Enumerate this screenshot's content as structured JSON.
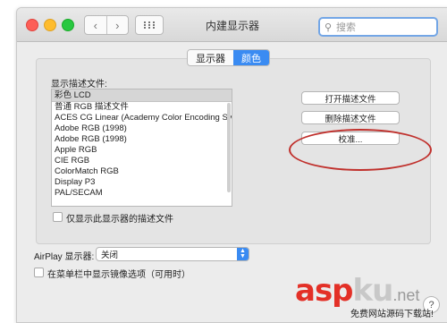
{
  "window": {
    "title": "内建显示器"
  },
  "toolbar": {
    "back": "‹",
    "forward": "›",
    "search_placeholder": "搜索"
  },
  "tabs": [
    {
      "label": "显示器",
      "selected": false
    },
    {
      "label": "颜色",
      "selected": true
    }
  ],
  "profiles": {
    "heading": "显示描述文件:",
    "selected": "彩色 LCD",
    "items": [
      "普通 RGB 描述文件",
      "ACES CG Linear (Academy Color Encoding Sy...",
      "Adobe RGB (1998)",
      "Adobe RGB (1998)",
      "Apple RGB",
      "CIE RGB",
      "ColorMatch RGB",
      "Display P3",
      "PAL/SECAM"
    ],
    "only_this_display": "仅显示此显示器的描述文件"
  },
  "buttons": {
    "open": "打开描述文件",
    "delete": "删除描述文件",
    "calibrate": "校准..."
  },
  "airplay": {
    "label": "AirPlay 显示器:",
    "value": "关闭"
  },
  "mirroring": {
    "label": "在菜单栏中显示镜像选项（可用时）"
  },
  "help": "?",
  "watermark": {
    "asp": "asp",
    "ku": "ku",
    "net": ".net",
    "sub": "免费网站源码下载站!"
  },
  "colors": {
    "accent": "#3a8bf2",
    "annotation": "#c0302c",
    "watermark": "#e33027"
  }
}
